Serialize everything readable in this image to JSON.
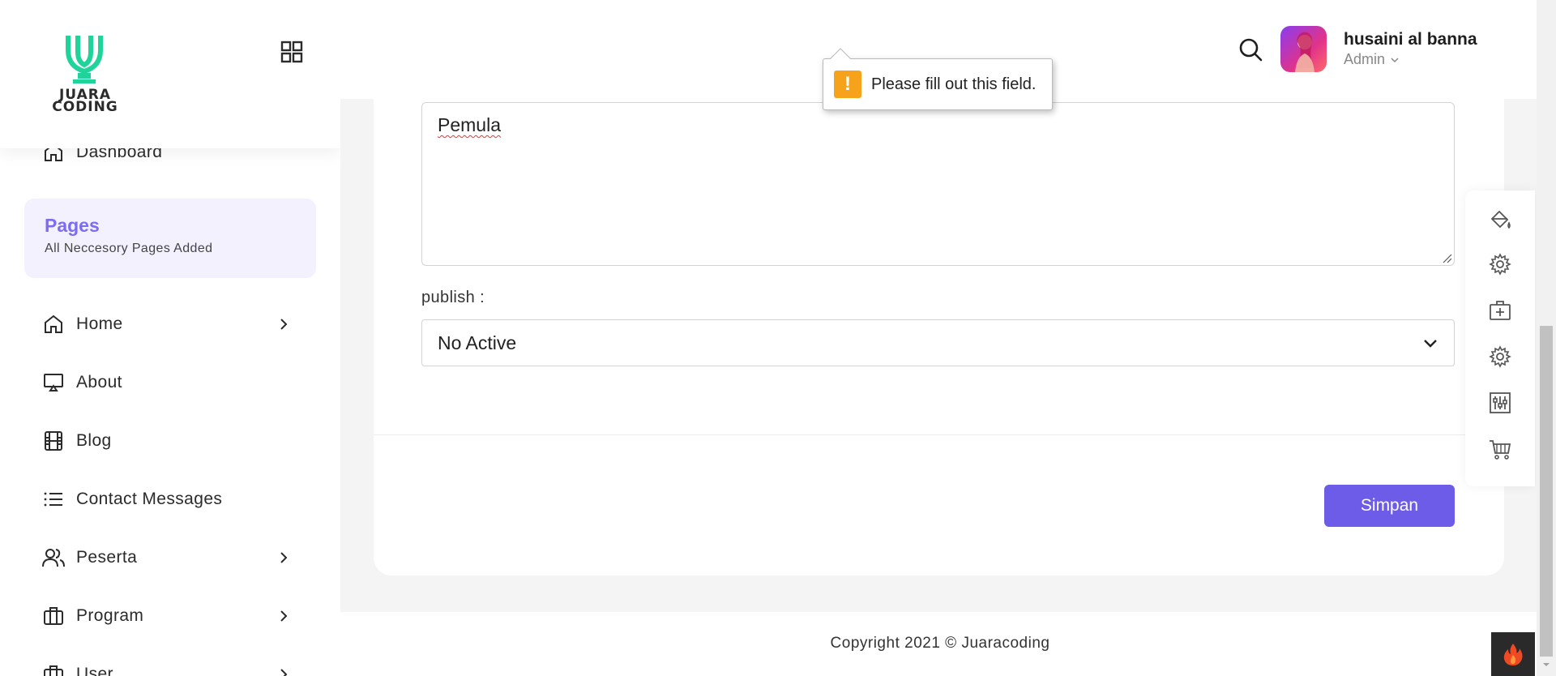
{
  "brand": {
    "line1": "JUARA",
    "line2": "CODING"
  },
  "sidebar": {
    "dashboard": "Dashboard",
    "section": {
      "title": "Pages",
      "subtitle": "All Neccesory Pages Added"
    },
    "items": [
      {
        "label": "Home",
        "icon": "home-icon",
        "has_children": true
      },
      {
        "label": "About",
        "icon": "monitor-icon",
        "has_children": false
      },
      {
        "label": "Blog",
        "icon": "film-icon",
        "has_children": false
      },
      {
        "label": "Contact Messages",
        "icon": "list-icon",
        "has_children": false
      },
      {
        "label": "Peserta",
        "icon": "users-icon",
        "has_children": true
      },
      {
        "label": "Program",
        "icon": "briefcase-icon",
        "has_children": true
      },
      {
        "label": "User",
        "icon": "briefcase-icon",
        "has_children": true
      }
    ]
  },
  "header": {
    "user_name": "husaini al banna",
    "user_role": "Admin"
  },
  "form": {
    "textarea_value": "Pemula",
    "publish_label": "publish :",
    "publish_selected": "No Active",
    "save_label": "Simpan"
  },
  "tooltip": {
    "icon": "!",
    "text": "Please fill out this field."
  },
  "footer": {
    "copyright": "Copyright 2021 © Juaracoding"
  },
  "tools": [
    "paint-bucket-icon",
    "gear-icon",
    "medical-bag-icon",
    "gear-icon",
    "sliders-icon",
    "cart-icon"
  ],
  "colors": {
    "accent": "#6c5ce7",
    "pages_title": "#7c6cf0",
    "logo_green": "#1fd39a",
    "warning": "#f7a21b"
  }
}
